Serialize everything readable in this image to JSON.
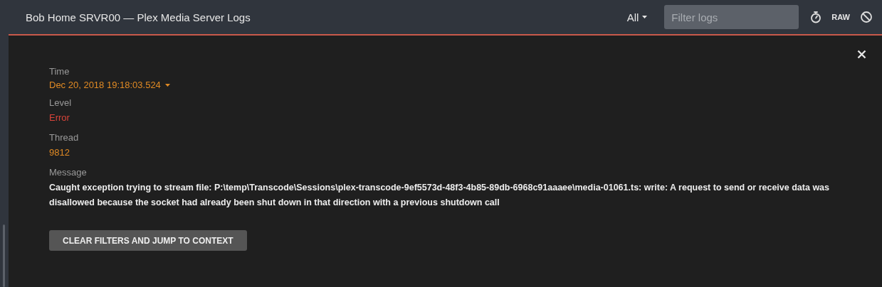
{
  "header": {
    "title": "Bob Home SRVR00 — Plex Media Server Logs",
    "level_filter": "All",
    "search": {
      "placeholder": "Filter logs"
    },
    "raw_button": "RAW"
  },
  "details": [
    {
      "kind": "time",
      "label": "Time",
      "value": "Dec 20, 2018 19:18:03.524"
    },
    {
      "kind": "level",
      "label": "Level",
      "value": "Error"
    },
    {
      "kind": "thread",
      "label": "Thread",
      "value": "9812"
    },
    {
      "kind": "message",
      "label": "Message",
      "value": "Caught exception trying to stream file: P:\\temp\\Transcode\\Sessions\\plex-transcode-9ef5573d-48f3-4b85-89db-6968c91aaaee\\media-01061.ts: write: A request to send or receive data was disallowed because the socket had already been shut down in that direction with a previous shutdown call"
    }
  ],
  "action_button": "CLEAR FILTERS AND JUMP TO CONTEXT"
}
